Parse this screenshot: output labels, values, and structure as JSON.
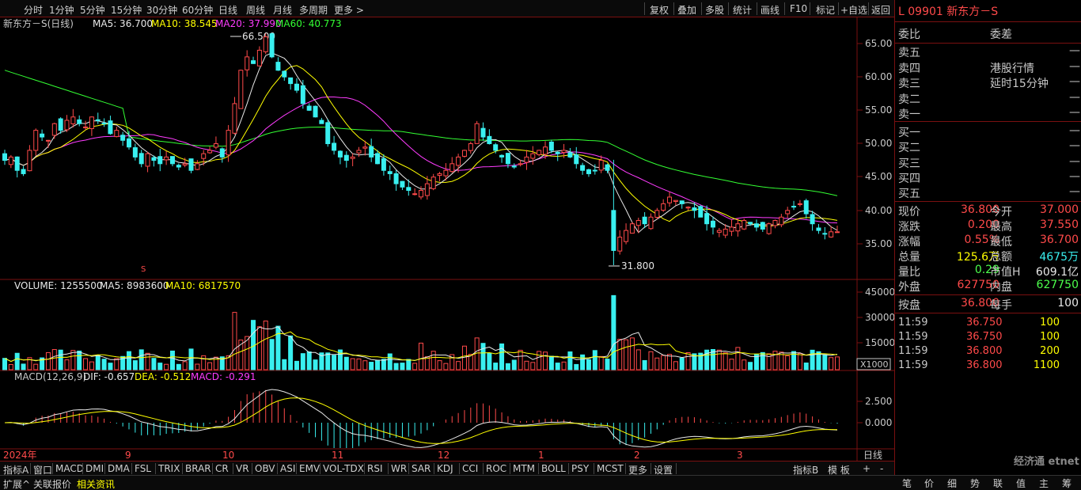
{
  "toolbar": {
    "periods": [
      "分时",
      "1分钟",
      "5分钟",
      "15分钟",
      "30分钟",
      "60分钟",
      "日线",
      "周线",
      "月线",
      "多周期",
      "更多"
    ],
    "actions": [
      "复权",
      "叠加",
      "多股",
      "统计",
      "画线",
      "F10",
      "标记",
      "+自选",
      "返回"
    ]
  },
  "stock": {
    "code": "L 09901",
    "name": "新东方－S"
  },
  "chart": {
    "title": "新东方－S(日线)",
    "ma": [
      {
        "label": "MA5: 36.700",
        "color": "#e8e8e8"
      },
      {
        "label": "MA10: 38.545",
        "color": "#ffff00"
      },
      {
        "label": "MA20: 37.990",
        "color": "#ff3cff"
      },
      {
        "label": "MA60: 40.773",
        "color": "#33ff33"
      }
    ],
    "high_label": "66.500",
    "low_label": "31.800",
    "price_ticks": [
      "65.00",
      "60.00",
      "55.00",
      "50.00",
      "45.00",
      "40.00",
      "35.00"
    ],
    "volume_title": "VOLUME: 1255500",
    "vol_ma5": "MA5: 8983600",
    "vol_ma10": "MA10: 6817570",
    "volume_ticks": [
      "45000",
      "30000",
      "15000"
    ],
    "volume_unit": "X1000",
    "macd_title": "MACD(12,26,9)",
    "macd_dif": "DIF: -0.657",
    "macd_dea": "DEA: -0.512",
    "macd_val": "MACD: -0.291",
    "macd_ticks": [
      "2.500",
      "0.000"
    ],
    "dates": [
      "2024年",
      "9",
      "10",
      "11",
      "12",
      "1",
      "2",
      "3"
    ],
    "period_label": "日线",
    "marker": "S"
  },
  "chart_data": {
    "type": "candlestick",
    "title": "新东方－S(日线)",
    "ylim": [
      31,
      68
    ],
    "closes": [
      47.5,
      48,
      46,
      45.5,
      49,
      52,
      51,
      50.5,
      53,
      52,
      53.5,
      54,
      53,
      52.5,
      54,
      53.5,
      53,
      51.5,
      52,
      50.5,
      49.5,
      48,
      47,
      48.5,
      47.5,
      47,
      48,
      47,
      46.5,
      47,
      46,
      47,
      48.5,
      49,
      50,
      48,
      52,
      56,
      61,
      63,
      62,
      64,
      66,
      63,
      61,
      60,
      59,
      58,
      56,
      55,
      54,
      53,
      50,
      49,
      48,
      47.5,
      48,
      49,
      49.5,
      48,
      47,
      46,
      45.5,
      44,
      43.5,
      43,
      42.5,
      43,
      44,
      45,
      45.5,
      46,
      47,
      48,
      49,
      50,
      53,
      51,
      50,
      49,
      48,
      47,
      46.5,
      47,
      48,
      48.5,
      49,
      49.5,
      49,
      48.5,
      49,
      48,
      47,
      46,
      45.5,
      46,
      47.5,
      46,
      34,
      36,
      37,
      38,
      38.5,
      38,
      39,
      40,
      41,
      42,
      41.5,
      41,
      40.5,
      40,
      39,
      38,
      37.5,
      37,
      37.2,
      37.5,
      38,
      38.5,
      38,
      37.5,
      37.2,
      38,
      38.5,
      39,
      40,
      40.5,
      41,
      39.5,
      38,
      37,
      36.5,
      36.8,
      36.8
    ],
    "price_ticks": [
      65,
      60,
      55,
      50,
      45,
      40,
      35
    ],
    "high": 66.5,
    "low": 31.8,
    "volume_ticks": [
      45000,
      30000,
      15000
    ],
    "volume_spike": 43000,
    "macd_ticks": [
      2.5,
      0.0
    ]
  },
  "quote": {
    "header_left": "委比",
    "header_right": "委差",
    "sell": [
      "卖五",
      "卖四",
      "卖三",
      "卖二",
      "卖一"
    ],
    "buy": [
      "买一",
      "买二",
      "买三",
      "买四",
      "买五"
    ],
    "dash": "—",
    "notice1": "港股行情",
    "notice2": "延时15分钟",
    "rows": [
      {
        "l1": "现价",
        "v1": "36.800",
        "l2": "今开",
        "v2": "37.000"
      },
      {
        "l1": "涨跌",
        "v1": "0.200",
        "l2": "最高",
        "v2": "37.550"
      },
      {
        "l1": "涨幅",
        "v1": "0.55%",
        "l2": "最低",
        "v2": "36.700"
      },
      {
        "l1": "总量",
        "v1": "125.6万",
        "l2": "总额",
        "v2": "4675万"
      },
      {
        "l1": "量比",
        "v1": "0.29",
        "l2": "市值H",
        "v2": "609.1亿"
      },
      {
        "l1": "外盘",
        "v1": "627750",
        "l2": "内盘",
        "v2": "627750"
      }
    ],
    "press_label": "按盘",
    "press_value": "36.800",
    "per_lot_label": "每手",
    "per_lot_value": "100",
    "ticks": [
      {
        "time": "11:59",
        "price": "36.750",
        "vol": "100"
      },
      {
        "time": "11:59",
        "price": "36.750",
        "vol": "100"
      },
      {
        "time": "11:59",
        "price": "36.800",
        "vol": "200"
      },
      {
        "time": "11:59",
        "price": "36.800",
        "vol": "1100"
      }
    ]
  },
  "bottom_tabs": [
    "指标A",
    "窗口",
    "MACD",
    "DMI",
    "DMA",
    "FSL",
    "TRIX",
    "BRAR",
    "CR",
    "VR",
    "OBV",
    "ASI",
    "EMV",
    "VOL-TDX",
    "RSI",
    "WR",
    "SAR",
    "KDJ",
    "CCI",
    "ROC",
    "MTM",
    "BOLL",
    "PSY",
    "MCST",
    "更多",
    "设置"
  ],
  "bottom_right": [
    "指标B",
    "模 板",
    "+",
    "-"
  ],
  "status": {
    "expand": "扩展^",
    "link1": "关联报价",
    "link2": "相关资讯"
  },
  "right_tabs": [
    "笔",
    "价",
    "细",
    "势",
    "联",
    "值",
    "主",
    "筹"
  ],
  "watermark": "经济通 etnet"
}
